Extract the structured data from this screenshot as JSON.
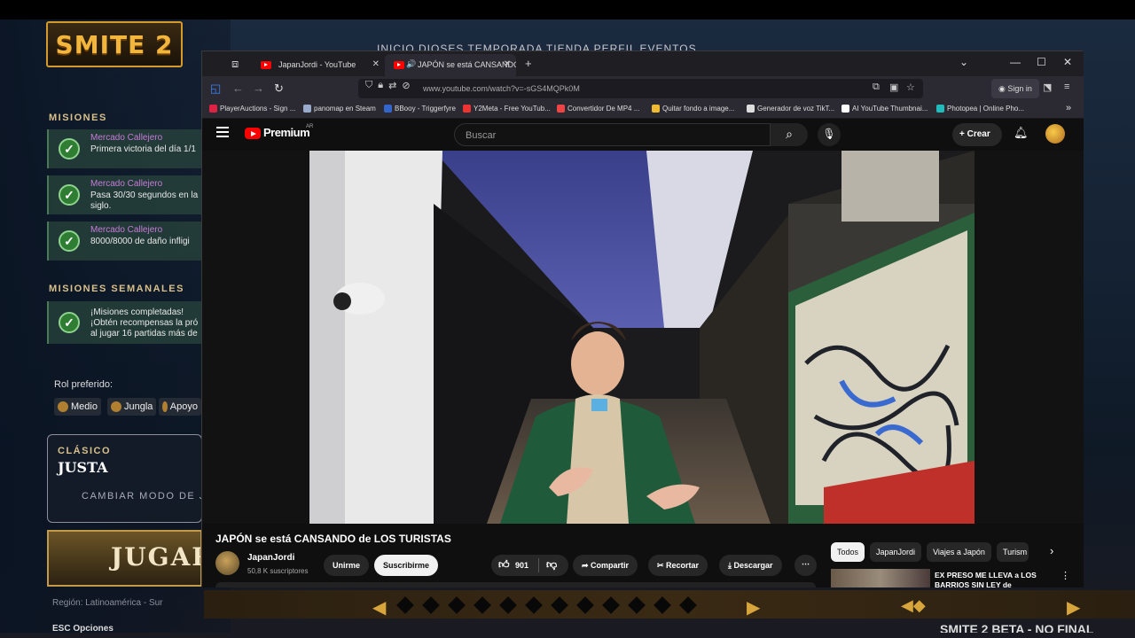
{
  "game": {
    "logo_text": "SMITE 2",
    "nav_ghost": "INICIO   DIOSES   TEMPORADA   TIENDA   PERFIL   EVENTOS",
    "missions_title": "MISIONES",
    "missions": [
      {
        "category": "Mercado Callejero",
        "desc": "Primera victoria del día 1/1"
      },
      {
        "category": "Mercado Callejero",
        "desc": "Pasa 30/30 segundos en la\nsiglo."
      },
      {
        "category": "Mercado Callejero",
        "desc": "8000/8000 de daño infligi"
      }
    ],
    "weekly_title": "MISIONES SEMANALES",
    "weekly": {
      "desc": "¡Misiones completadas!\n¡Obtén recompensas la pró\nal jugar 16 partidas más de"
    },
    "role_label": "Rol preferido:",
    "roles": [
      "Medio",
      "Jungla",
      "Apoyo"
    ],
    "mode_type": "CLÁSICO",
    "mode_name": "JUSTA",
    "mode_change": "CAMBIAR MODO DE J",
    "play_label": "JUGAR",
    "region": "Región: Latinoamérica - Sur",
    "esc_label": "ESC  Opciones",
    "beta_text": "SMITE 2  BETA - NO FINAL"
  },
  "browser": {
    "tabs": [
      {
        "label": "JapanJordi - YouTube",
        "active": false
      },
      {
        "label": "JAPÓN se está CANSANDO",
        "active": true
      }
    ],
    "url": "www.youtube.com/watch?v=-sGS4MQPk0M",
    "signin": "Sign in",
    "bookmarks": [
      {
        "label": "PlayerAuctions - Sign ...",
        "color": "#d24"
      },
      {
        "label": "panomap en Steam",
        "color": "#9ac"
      },
      {
        "label": "BBooy - Triggerfyre",
        "color": "#36c"
      },
      {
        "label": "Y2Meta - Free YouTub...",
        "color": "#e33"
      },
      {
        "label": "Convertidor De MP4 ...",
        "color": "#e44"
      },
      {
        "label": "Quitar fondo a image...",
        "color": "#eb3"
      },
      {
        "label": "Generador de voz TikT...",
        "color": "#ddd"
      },
      {
        "label": "AI YouTube Thumbnai...",
        "color": "#fff"
      },
      {
        "label": "Photopea | Online Pho...",
        "color": "#2bb"
      }
    ]
  },
  "youtube": {
    "brand": "Premium",
    "country": "AR",
    "search_placeholder": "Buscar",
    "create_label": "Crear",
    "video_title": "JAPÓN se está CANSANDO de LOS TURISTAS",
    "channel_name": "JapanJordi",
    "subscribers": "50,8 K suscriptores",
    "join_label": "Unirme",
    "subscribe_label": "Suscribirme",
    "likes": "901",
    "share_label": "Compartir",
    "clip_label": "Recortar",
    "download_label": "Descargar",
    "chips": [
      "Todos",
      "JapanJordi",
      "Viajes a Japón",
      "Turism"
    ],
    "reco_title": "EX PRESO ME LLEVA a LOS BARRIOS SIN LEY de ROSARI"
  }
}
